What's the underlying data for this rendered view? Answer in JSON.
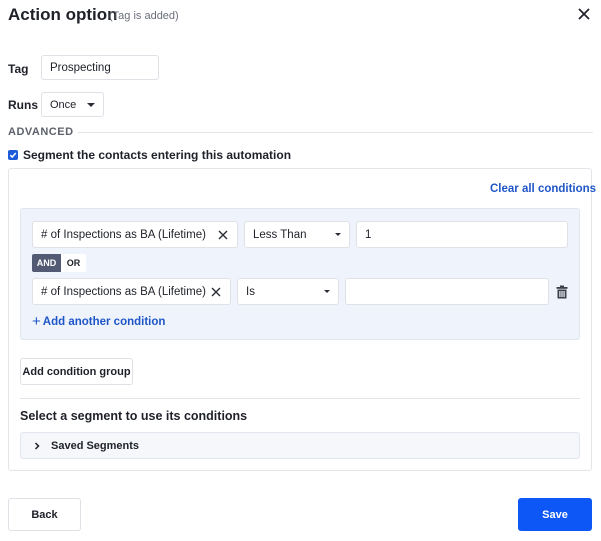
{
  "header": {
    "title": "Action option",
    "subtitle": "(Tag is added)",
    "close_icon": "close-icon"
  },
  "form": {
    "tag_label": "Tag",
    "tag_value": "Prospecting",
    "runs_label": "Runs",
    "runs_value": "Once"
  },
  "advanced": {
    "section_label": "ADVANCED",
    "segment_checkbox_label": "Segment the contacts entering this automation",
    "segment_checked": true
  },
  "conditions": {
    "clear_all_label": "Clear all conditions",
    "rows": [
      {
        "field": "# of Inspections as BA (Lifetime)",
        "operator": "Less Than",
        "value": "1"
      },
      {
        "field": "# of Inspections as BA (Lifetime)",
        "operator": "Is",
        "value": ""
      }
    ],
    "logic": {
      "and_label": "AND",
      "or_label": "OR",
      "selected": "AND"
    },
    "add_condition_label": "Add another condition",
    "add_group_label": "Add condition group"
  },
  "segments": {
    "title": "Select a segment to use its conditions",
    "saved_label": "Saved Segments"
  },
  "footer": {
    "back_label": "Back",
    "save_label": "Save"
  },
  "colors": {
    "accent": "#0c57f6",
    "link": "#1f56c7",
    "group_bg": "#eff4fc",
    "and_active": "#525b73"
  }
}
